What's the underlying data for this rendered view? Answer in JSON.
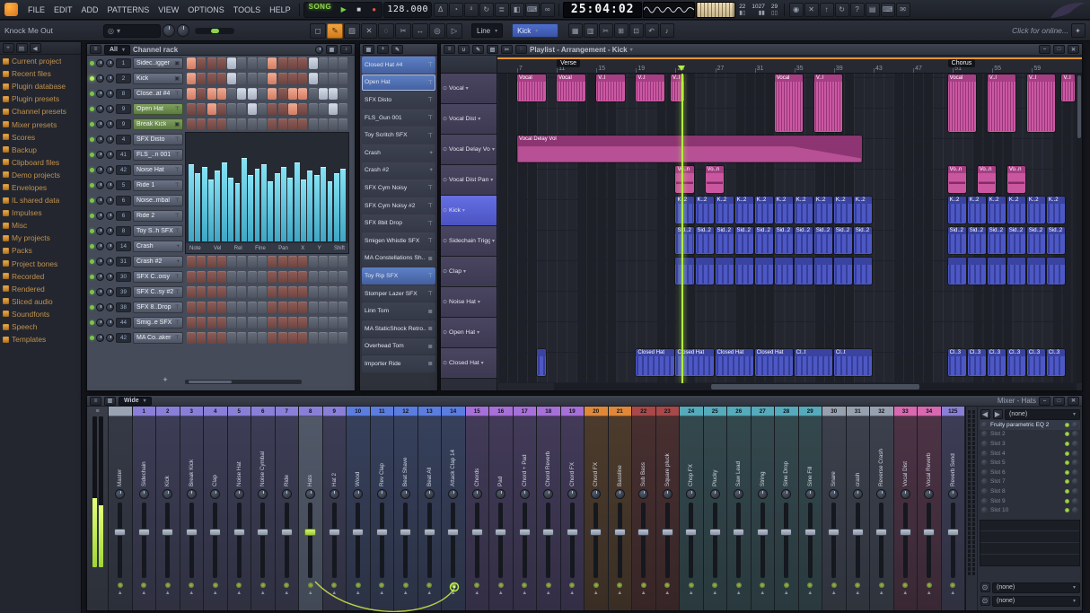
{
  "colors": {
    "accent_green": "#b3ef3e",
    "selection_blue": "#4e6fce",
    "clip_pink": "#cb58a2",
    "clip_blue": "#4d58c4",
    "groups": {
      "master": "#9aa3b2",
      "purple": "#8a7fd8",
      "blue": "#5b7de0",
      "violet": "#a76fd8",
      "orange": "#e08838",
      "maroon": "#a84848",
      "teal": "#55aabb",
      "gray": "#97a0ae",
      "pink": "#d868b0",
      "purple2": "#8a7fd8"
    }
  },
  "icons": {
    "metronome": "Δ",
    "wait-input": "◔",
    "countdown": "³",
    "loop-record": "↻",
    "overdub": "≣",
    "step-edit": "◧",
    "typing-keyboard": "⌨",
    "multilink": "∞",
    "power": "◉",
    "close": "✕",
    "upload": "↑",
    "refresh": "↻",
    "help": "?",
    "file": "▤",
    "keyboard": "⌨",
    "chat": "✉",
    "select": "◻",
    "draw": "✎",
    "paint": "▨",
    "delete": "✕",
    "mute": "◌",
    "slice": "✂",
    "slip": "↔",
    "zoom": "◎",
    "playback": "▷",
    "grid": "▦",
    "pattern": "▥",
    "cut": "✂",
    "copy": "⊞",
    "paste": "⊡",
    "undo": "↶",
    "piano": "♪",
    "menu": "≡",
    "plus": "+",
    "pencil": "✎",
    "magnet": "∪",
    "min": "–",
    "max": "□",
    "closew": "✕",
    "arrowL": "◀",
    "arrowR": "▶",
    "down": "▾",
    "search": "◎",
    "gift": "✦"
  },
  "menubar": {
    "menus": [
      "FILE",
      "EDIT",
      "ADD",
      "PATTERNS",
      "VIEW",
      "OPTIONS",
      "TOOLS",
      "HELP"
    ],
    "mode": "SONG",
    "tempo": "128.000",
    "time": "25:04:02",
    "cpu": "22",
    "mem": "1027",
    "bar": "29",
    "left_icons": [
      "metronome",
      "wait-input",
      "countdown",
      "loop-record",
      "overdub",
      "step-edit",
      "typing-keyboard",
      "multilink"
    ],
    "right_icons": [
      "power",
      "close",
      "upload",
      "refresh",
      "help",
      "file",
      "keyboard",
      "chat"
    ]
  },
  "toolbar": {
    "project_title": "Knock Me Out",
    "tools": [
      "select",
      "draw",
      "paint",
      "delete",
      "mute",
      "slice",
      "slip",
      "zoom",
      "playback"
    ],
    "active_tool": "draw",
    "snap_label": "Line",
    "target_label": "Kick",
    "right_icons": [
      "grid",
      "pattern",
      "cut",
      "copy",
      "paste",
      "undo",
      "piano"
    ],
    "online_hint": "Click for online..."
  },
  "browser": {
    "items": [
      "Current project",
      "Recent files",
      "Plugin database",
      "Plugin presets",
      "Channel presets",
      "Mixer presets",
      "Scores",
      "Backup",
      "Clipboard files",
      "Demo projects",
      "Envelopes",
      "IL shared data",
      "Impulses",
      "Misc",
      "My projects",
      "Packs",
      "Project bones",
      "Recorded",
      "Rendered",
      "Sliced audio",
      "Soundfonts",
      "Speech",
      "Templates"
    ]
  },
  "channel_rack": {
    "title": "Channel rack",
    "filter_label": "All",
    "add_label": "+",
    "channels": [
      {
        "num": "1",
        "name": "Sidec..igger",
        "icon": "plugin",
        "steps": "1000100010001000"
      },
      {
        "num": "2",
        "name": "Kick",
        "icon": "plugin",
        "selected": true,
        "steps": "1000100010001000"
      },
      {
        "num": "8",
        "name": "Close..at #4",
        "icon": "sampler",
        "steps": "1011011010110110"
      },
      {
        "num": "9",
        "name": "Open Hat",
        "icon": "sampler",
        "hl": true,
        "steps": "0010001000100010"
      },
      {
        "num": "9",
        "name": "Break Kick",
        "icon": "plugin",
        "hl": true,
        "steps": "0000000000000000"
      },
      {
        "num": "4",
        "name": "SFX Disto",
        "icon": "sampler",
        "steps": "0000000000000000"
      },
      {
        "num": "41",
        "name": "FLS_..n 001",
        "icon": "sampler",
        "steps": "0000000000000000"
      },
      {
        "num": "42",
        "name": "Noise Hat",
        "icon": "sampler",
        "steps": "0000000000000000"
      },
      {
        "num": "5",
        "name": "Ride 1",
        "icon": "sampler",
        "steps": "0000000000000000"
      },
      {
        "num": "6",
        "name": "Noise..mbal",
        "icon": "sampler",
        "steps": "0000000000000000"
      },
      {
        "num": "6",
        "name": "Ride 2",
        "icon": "sampler",
        "steps": "0000000000000000"
      },
      {
        "num": "8",
        "name": "Toy S..h SFX",
        "icon": "sampler",
        "steps": "0000000000000000"
      },
      {
        "num": "14",
        "name": "Crash",
        "icon": "plus",
        "steps": "0000000000000000"
      },
      {
        "num": "31",
        "name": "Crash #2",
        "icon": "plus",
        "steps": "0000000000000000"
      },
      {
        "num": "30",
        "name": "SFX C..oisy",
        "icon": "sampler",
        "steps": "0000000000000000"
      },
      {
        "num": "39",
        "name": "SFX C..sy #2",
        "icon": "sampler",
        "steps": "0000000000000000"
      },
      {
        "num": "38",
        "name": "SFX 8..Drop",
        "icon": "sampler",
        "steps": "0000000000000000"
      },
      {
        "num": "44",
        "name": "Smig..e SFX",
        "icon": "sampler",
        "steps": "0000000000000000"
      },
      {
        "num": "42",
        "name": "MA Co..aker",
        "icon": "sampler",
        "steps": "0000000000000000"
      }
    ],
    "graph": {
      "labels": [
        "Note",
        "Vel",
        "Rel",
        "Fine",
        "Pan",
        "X",
        "Y",
        "Shift"
      ],
      "bars": [
        72,
        64,
        70,
        58,
        66,
        74,
        60,
        55,
        78,
        62,
        68,
        72,
        56,
        64,
        70,
        60,
        74,
        58,
        66,
        62,
        70,
        56,
        64,
        68
      ]
    }
  },
  "picker": {
    "items": [
      {
        "label": "Closed Hat #4",
        "icon": "sampler",
        "sel": "on"
      },
      {
        "label": "Open Hat",
        "icon": "sampler",
        "sel": "focus"
      },
      {
        "label": "SFX Disto",
        "icon": "sampler"
      },
      {
        "label": "FLS_Gun 001",
        "icon": "sampler"
      },
      {
        "label": "Toy Scritch SFX",
        "icon": "sampler"
      },
      {
        "label": "Crash",
        "icon": "plus"
      },
      {
        "label": "Crash #2",
        "icon": "plus"
      },
      {
        "label": "SFX Cym Noisy",
        "icon": "sampler"
      },
      {
        "label": "SFX Cym Noisy #2",
        "icon": "sampler"
      },
      {
        "label": "SFX 8bit Drop",
        "icon": "sampler"
      },
      {
        "label": "Smigen Whistle SFX",
        "icon": "sampler"
      },
      {
        "label": "MA Constellations Sh..",
        "icon": "layer"
      },
      {
        "label": "Toy Rip SFX",
        "icon": "sampler",
        "sel": "on"
      },
      {
        "label": "Stomper Lazer SFX",
        "icon": "sampler"
      },
      {
        "label": "Linn Tom",
        "icon": "layer"
      },
      {
        "label": "MA StaticShock Retro..",
        "icon": "layer"
      },
      {
        "label": "Overhead Tom",
        "icon": "layer"
      },
      {
        "label": "Importer Ride",
        "icon": "layer"
      }
    ]
  },
  "playlist": {
    "title": "Playlist - Arrangement - Kick",
    "bar_start": 5,
    "bar_end": 63.5,
    "ruler": {
      "start": 7,
      "step": 4,
      "count": 14
    },
    "playhead_bar": 23.6,
    "markers": [
      {
        "label": "Verse",
        "bar": 11
      },
      {
        "label": "Chorus",
        "bar": 50.5
      }
    ],
    "selected_track": 4,
    "tracks": [
      "Vocal",
      "Vocal Dist",
      "Vocal Delay Vol",
      "Vocal Dist Pan",
      "Kick",
      "Sidechain Trigger",
      "Clap",
      "Noise Hat",
      "Open Hat",
      "Closed Hat"
    ],
    "clips": [
      {
        "t": 0,
        "b": 7,
        "l": 3,
        "label": "Vocal",
        "c": "pink"
      },
      {
        "t": 0,
        "b": 11,
        "l": 3,
        "label": "Vocal",
        "c": "pink"
      },
      {
        "t": 0,
        "b": 15,
        "l": 3,
        "label": "V..l",
        "c": "pink"
      },
      {
        "t": 0,
        "b": 19,
        "l": 3,
        "label": "V..l",
        "c": "pink"
      },
      {
        "t": 0,
        "b": 22.5,
        "l": 1.5,
        "label": "V..l",
        "c": "pink"
      },
      {
        "t": 0,
        "b": 33,
        "l": 3,
        "label": "Vocal",
        "c": "pink",
        "rows": 2
      },
      {
        "t": 0,
        "b": 37,
        "l": 3,
        "label": "V..l",
        "c": "pink",
        "rows": 2
      },
      {
        "t": 0,
        "b": 50.5,
        "l": 3,
        "label": "Vocal",
        "c": "pink",
        "rows": 2
      },
      {
        "t": 0,
        "b": 54.5,
        "l": 3,
        "label": "V..l",
        "c": "pink",
        "rows": 2
      },
      {
        "t": 0,
        "b": 58.5,
        "l": 3,
        "label": "V..l",
        "c": "pink",
        "rows": 2
      },
      {
        "t": 0,
        "b": 62,
        "l": 1.5,
        "label": "V..l",
        "c": "pink"
      },
      {
        "t": 2,
        "b": 7,
        "l": 35,
        "label": "Vocal Delay Vol",
        "c": "auto"
      },
      {
        "t": 3,
        "b": 23,
        "l": 2,
        "label": "Vo..n",
        "c": "vpan"
      },
      {
        "t": 3,
        "b": 26,
        "l": 2,
        "label": "Vo..n",
        "c": "vpan"
      },
      {
        "t": 3,
        "b": 50.5,
        "l": 2,
        "label": "Vo..n",
        "c": "vpan"
      },
      {
        "t": 3,
        "b": 53.5,
        "l": 2,
        "label": "Vo..n",
        "c": "vpan"
      },
      {
        "t": 3,
        "b": 56.5,
        "l": 2,
        "label": "Vo..n",
        "c": "vpan"
      },
      {
        "t": 4,
        "b": 23,
        "l": 2,
        "label": "K..2",
        "c": "blue",
        "n": 10
      },
      {
        "t": 4,
        "b": 50.5,
        "l": 2,
        "label": "K..2",
        "c": "blue",
        "n": 6
      },
      {
        "t": 5,
        "b": 23,
        "l": 2,
        "label": "Sid..2",
        "c": "blue",
        "n": 10
      },
      {
        "t": 5,
        "b": 50.5,
        "l": 2,
        "label": "Sid..2",
        "c": "blue",
        "n": 6
      },
      {
        "t": 6,
        "b": 23,
        "l": 2,
        "label": "",
        "c": "blue",
        "n": 10
      },
      {
        "t": 6,
        "b": 50.5,
        "l": 2,
        "label": "",
        "c": "blue",
        "n": 6
      },
      {
        "t": 9,
        "b": 9,
        "l": 1,
        "label": "",
        "c": "blue"
      },
      {
        "t": 9,
        "b": 19,
        "l": 4,
        "label": "Closed Hat",
        "c": "blue",
        "n": 4
      },
      {
        "t": 9,
        "b": 35,
        "l": 4,
        "label": "Cl..t",
        "c": "blue",
        "n": 2
      },
      {
        "t": 9,
        "b": 50.5,
        "l": 2,
        "label": "Cl..3",
        "c": "blue",
        "n": 6
      }
    ]
  },
  "mixer": {
    "title": "Mixer - Hats",
    "view_label": "Wide",
    "strips": [
      {
        "num": "",
        "name": "Master",
        "grp": "master"
      },
      {
        "num": "1",
        "name": "Sidechain",
        "grp": "purple"
      },
      {
        "num": "2",
        "name": "Kick",
        "grp": "purple"
      },
      {
        "num": "3",
        "name": "Break Kick",
        "grp": "purple"
      },
      {
        "num": "4",
        "name": "Clap",
        "grp": "purple"
      },
      {
        "num": "5",
        "name": "Noise Hat",
        "grp": "purple"
      },
      {
        "num": "6",
        "name": "Noise Cymbal",
        "grp": "purple"
      },
      {
        "num": "7",
        "name": "Ride",
        "grp": "purple"
      },
      {
        "num": "8",
        "name": "Hats",
        "grp": "purple",
        "selected": true
      },
      {
        "num": "9",
        "name": "Hat 2",
        "grp": "purple"
      },
      {
        "num": "10",
        "name": "Wood",
        "grp": "blue"
      },
      {
        "num": "11",
        "name": "Rev Clap",
        "grp": "blue"
      },
      {
        "num": "12",
        "name": "Beat Shave",
        "grp": "blue"
      },
      {
        "num": "13",
        "name": "Beat All",
        "grp": "blue"
      },
      {
        "num": "14",
        "name": "Attack Clap 14",
        "grp": "blue"
      },
      {
        "num": "15",
        "name": "Chords",
        "grp": "violet"
      },
      {
        "num": "16",
        "name": "Pad",
        "grp": "violet"
      },
      {
        "num": "17",
        "name": "Chord + Pad",
        "grp": "violet"
      },
      {
        "num": "18",
        "name": "Chord Reverb",
        "grp": "violet"
      },
      {
        "num": "19",
        "name": "Chord FX",
        "grp": "violet"
      },
      {
        "num": "20",
        "name": "Chord FX",
        "grp": "orange"
      },
      {
        "num": "21",
        "name": "Bassline",
        "grp": "orange"
      },
      {
        "num": "22",
        "name": "Sub Bass",
        "grp": "maroon"
      },
      {
        "num": "23",
        "name": "Square pluck",
        "grp": "maroon"
      },
      {
        "num": "24",
        "name": "Chop FX",
        "grp": "teal"
      },
      {
        "num": "25",
        "name": "Plucky",
        "grp": "teal"
      },
      {
        "num": "26",
        "name": "Saw Lead",
        "grp": "teal"
      },
      {
        "num": "27",
        "name": "String",
        "grp": "teal"
      },
      {
        "num": "28",
        "name": "Sine Drop",
        "grp": "teal"
      },
      {
        "num": "29",
        "name": "Sine Fill",
        "grp": "teal"
      },
      {
        "num": "30",
        "name": "Snare",
        "grp": "gray"
      },
      {
        "num": "31",
        "name": "crash",
        "grp": "gray"
      },
      {
        "num": "32",
        "name": "Reverse Crash",
        "grp": "gray"
      },
      {
        "num": "33",
        "name": "Vocal Dist",
        "grp": "pink"
      },
      {
        "num": "34",
        "name": "Vocal Reverb",
        "grp": "pink"
      },
      {
        "num": "125",
        "name": "Reverb Send",
        "grp": "purple2"
      }
    ]
  },
  "fx": {
    "preset_selector": "(none)",
    "slots": [
      "Fruity parametric EQ 2",
      "Slot 2",
      "Slot 3",
      "Slot 4",
      "Slot 5",
      "Slot 6",
      "Slot 7",
      "Slot 8",
      "Slot 9",
      "Slot 10"
    ],
    "bottom_selectors": [
      "(none)",
      "(none)"
    ]
  }
}
